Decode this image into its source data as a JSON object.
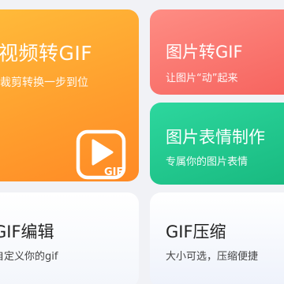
{
  "cards": {
    "video_to_gif": {
      "title": "视频转GIF",
      "subtitle": "裁剪转换一步到位",
      "badge": "GIF",
      "icon": "video-play-gif-icon"
    },
    "image_to_gif": {
      "title": "图片转GIF",
      "subtitle": "让图片“动”起来"
    },
    "emoji_maker": {
      "title": "图片表情制作",
      "subtitle": "专属你的图片表情"
    },
    "gif_edit": {
      "title": "GIF编辑",
      "subtitle": "自定义你的gif"
    },
    "gif_compress": {
      "title": "GIF压缩",
      "subtitle": "大小可选，压缩便捷"
    }
  },
  "colors": {
    "orange": "#ff9f2e",
    "red": "#f6635e",
    "green": "#18b97f",
    "background": "#f1f2f6"
  }
}
